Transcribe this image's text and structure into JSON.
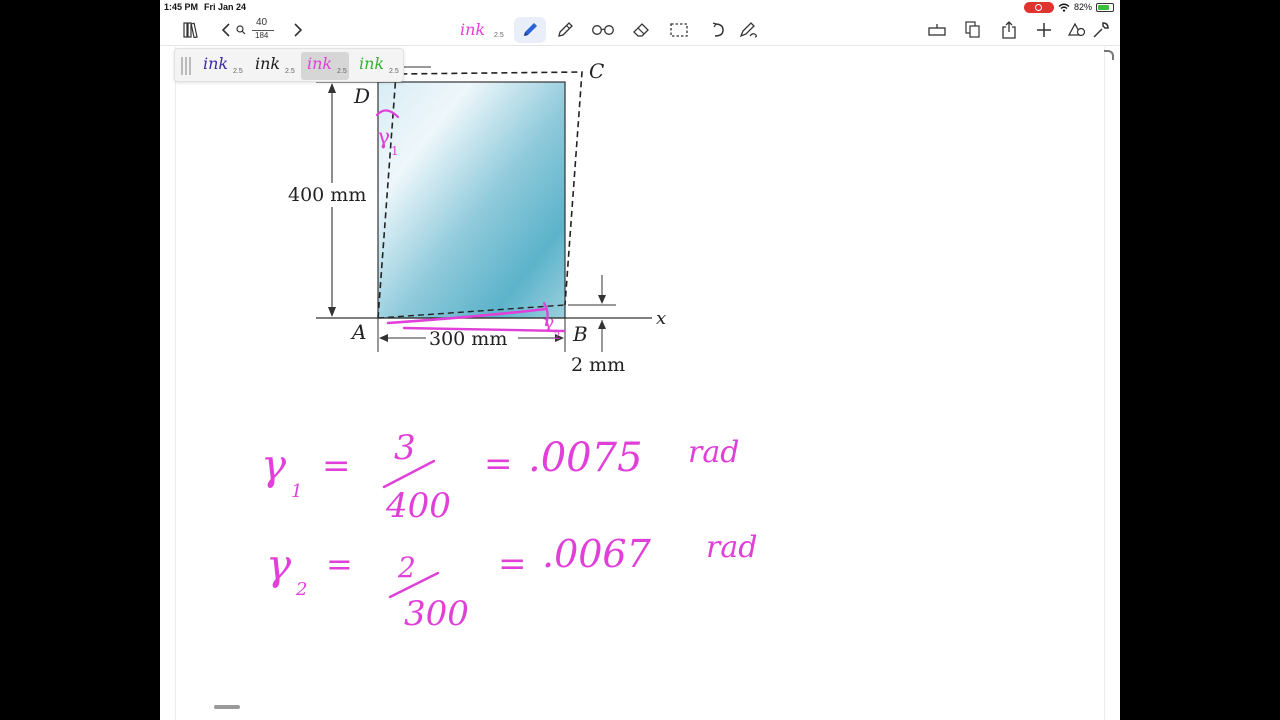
{
  "status_bar": {
    "time": "1:45 PM",
    "date": "Fri Jan 24",
    "battery_percent": "82%",
    "battery_level": 0.82
  },
  "toolbar": {
    "page_current": "40",
    "page_total": "184",
    "active_pen_label": "ink",
    "active_pen_size": "2.5",
    "icons": [
      "library-icon",
      "back-chevron-icon",
      "search-icon",
      "forward-chevron-icon",
      "pen-icon",
      "highlighter-icon",
      "reading-glasses-icon",
      "eraser-icon",
      "lasso-select-icon",
      "undo-icon",
      "text-shape-icon",
      "add-page-icon",
      "copy-icon",
      "share-icon",
      "plus-icon",
      "shapes-icon",
      "wrench-icon"
    ]
  },
  "pen_presets": [
    {
      "label": "ink",
      "size": "2.5",
      "color": "#3a2aa8",
      "selected": false
    },
    {
      "label": "ink",
      "size": "2.5",
      "color": "#1a1a1a",
      "selected": false
    },
    {
      "label": "ink",
      "size": "2.5",
      "color": "#e040d8",
      "selected": true
    },
    {
      "label": "ink",
      "size": "2.5",
      "color": "#35b035",
      "selected": false
    }
  ],
  "figure": {
    "label_C": "C",
    "label_D": "D",
    "label_A": "A",
    "label_B": "B",
    "label_x": "x",
    "dim_height": "400 mm",
    "dim_width": "300 mm",
    "dim_small": "2 mm",
    "plate_color": "#7ec3d6"
  },
  "handwriting": {
    "ink_color": "#e040d8",
    "gamma1": {
      "symbol": "γ",
      "subscript": "1",
      "eq": "=",
      "numerator": "3",
      "denominator": "400",
      "result": ".0075",
      "unit": "rad"
    },
    "gamma2": {
      "symbol": "γ",
      "subscript": "2",
      "eq": "=",
      "numerator": "2",
      "denominator": "300",
      "result": ".0067",
      "unit": "rad"
    },
    "figure_marks": {
      "gamma_top": "γ",
      "gamma_top_sub": "1",
      "gamma_bottom": "γ",
      "gamma_bottom_sub": "2"
    }
  }
}
